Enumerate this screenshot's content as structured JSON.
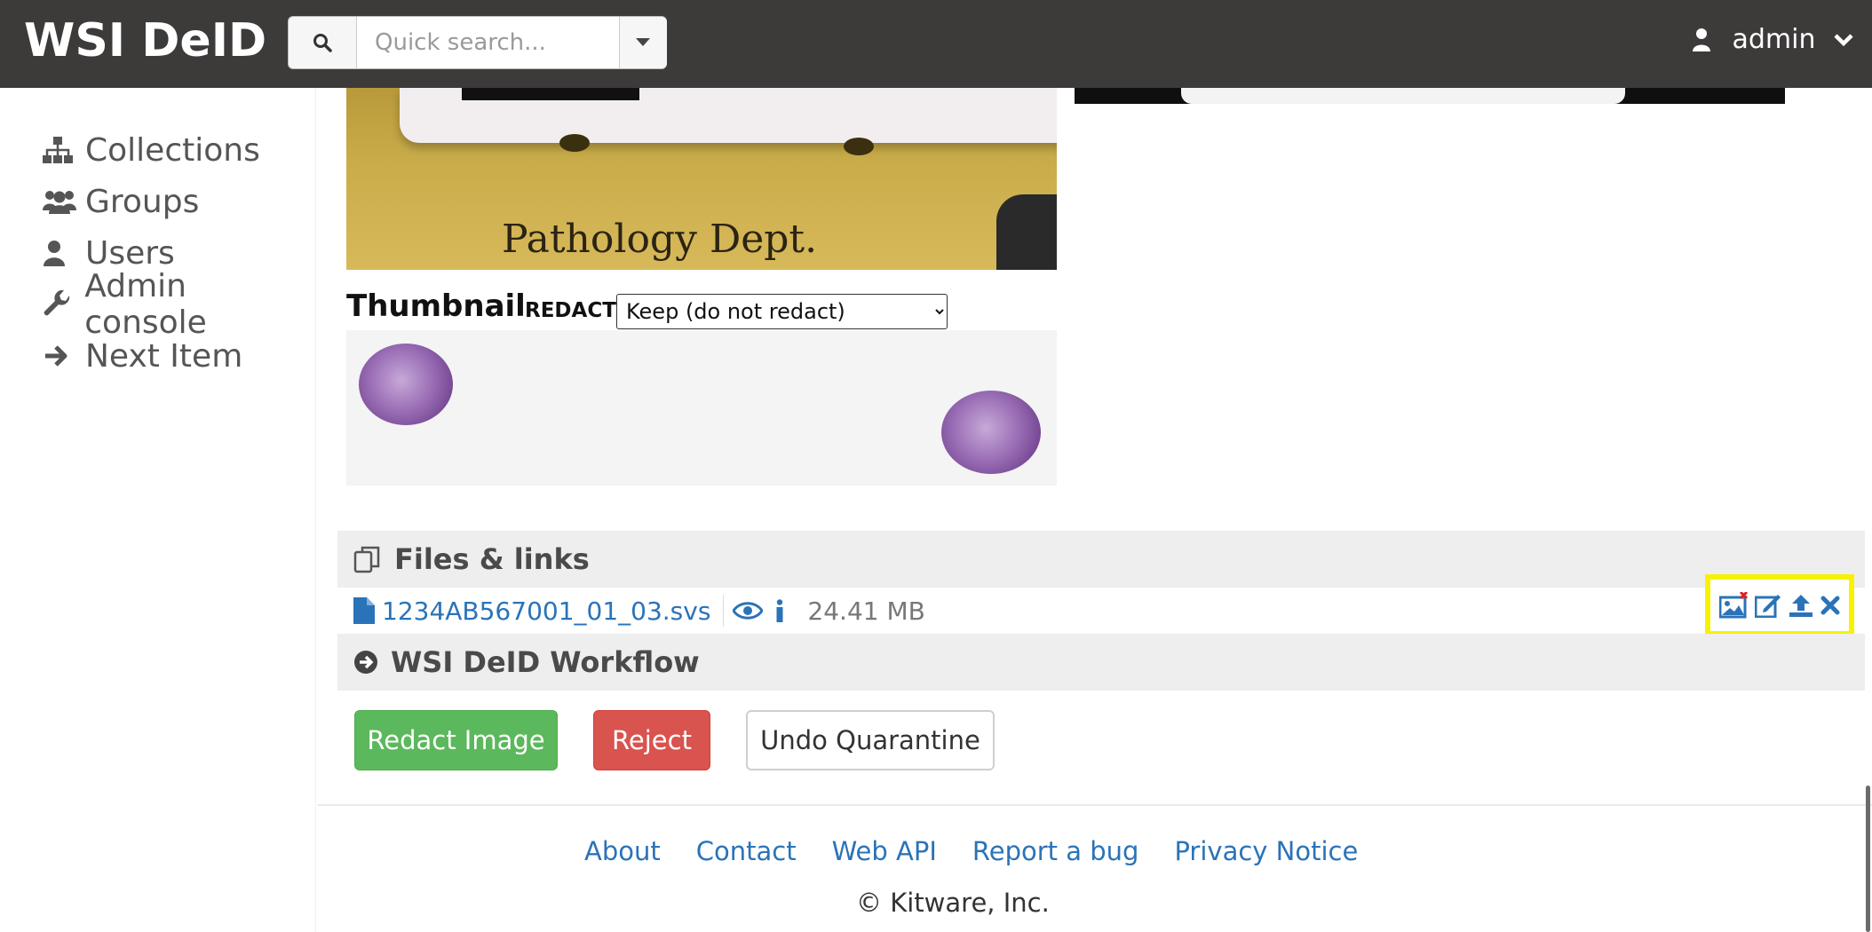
{
  "header": {
    "brand": "WSI DeID",
    "search": {
      "placeholder": "Quick search..."
    },
    "user": "admin"
  },
  "sidebar": {
    "items": [
      {
        "label": "Collections",
        "icon": "sitemap-icon"
      },
      {
        "label": "Groups",
        "icon": "users-icon"
      },
      {
        "label": "Users",
        "icon": "user-icon"
      },
      {
        "label": "Admin console",
        "icon": "wrench-icon"
      },
      {
        "label": "Next Item",
        "icon": "arrow-right-icon"
      }
    ]
  },
  "label_image": {
    "visible_text": "Pathology Dept."
  },
  "thumbnail": {
    "title": "Thumbnail",
    "redact_label": "REDACT",
    "redact_selected": "Keep (do not redact)"
  },
  "files": {
    "heading": "Files & links",
    "file_name": "1234AB567001_01_03.svs",
    "file_size": "24.41 MB"
  },
  "workflow": {
    "heading": "WSI DeID Workflow",
    "buttons": {
      "redact": "Redact Image",
      "reject": "Reject",
      "undo": "Undo Quarantine"
    }
  },
  "footer": {
    "links": [
      "About",
      "Contact",
      "Web API",
      "Report a bug",
      "Privacy Notice"
    ],
    "copyright": "© Kitware, Inc."
  },
  "colors": {
    "topbar": "#3d3a3a",
    "link": "#2a73b8",
    "success": "#5cb85c",
    "danger": "#d9534f",
    "highlight": "#f6f200"
  }
}
